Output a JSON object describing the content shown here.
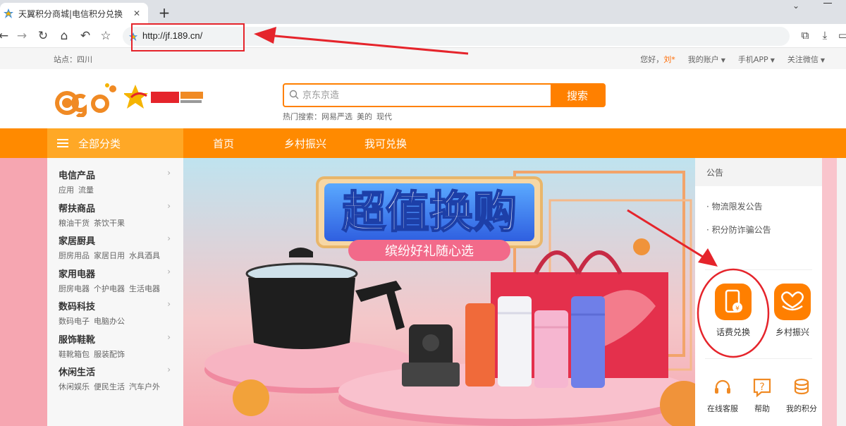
{
  "browser": {
    "tab_title": "天翼积分商城|电信积分兑换",
    "close_glyph": "✕",
    "new_tab_glyph": "+",
    "url": "http://jf.189.cn/"
  },
  "topbar": {
    "region": "站点：四川",
    "greeting": "您好，",
    "username": "刘*",
    "links": [
      "我的账户",
      "手机APP",
      "关注微信"
    ]
  },
  "header": {
    "search_placeholder": "京东京造",
    "search_button": "搜索",
    "hot_label": "热门搜索：",
    "hot_terms": [
      "网易严选",
      "美的",
      "现代"
    ]
  },
  "nav": {
    "all_categories": "全部分类",
    "links": [
      "首页",
      "乡村振兴",
      "我可兑换"
    ]
  },
  "categories": [
    {
      "name": "电信产品",
      "subs": [
        "应用",
        "流量"
      ]
    },
    {
      "name": "帮扶商品",
      "subs": [
        "粮油干货",
        "茶饮干果"
      ]
    },
    {
      "name": "家居厨具",
      "subs": [
        "厨房用品",
        "家居日用",
        "水具酒具"
      ]
    },
    {
      "name": "家用电器",
      "subs": [
        "厨房电器",
        "个护电器",
        "生活电器"
      ]
    },
    {
      "name": "数码科技",
      "subs": [
        "数码电子",
        "电脑办公"
      ]
    },
    {
      "name": "服饰鞋靴",
      "subs": [
        "鞋靴箱包",
        "服装配饰"
      ]
    },
    {
      "name": "休闲生活",
      "subs": [
        "休闲娱乐",
        "便民生活",
        "汽车户外"
      ]
    }
  ],
  "banner": {
    "headline": "超值换购",
    "subline": "缤纷好礼随心选"
  },
  "panel": {
    "notice_title": "公告",
    "notices": [
      "物流限发公告",
      "积分防诈骗公告"
    ],
    "services": [
      "话费兑换",
      "乡村振兴"
    ],
    "help": [
      "在线客服",
      "帮助",
      "我的积分"
    ]
  },
  "colors": {
    "brand_orange": "#ff8000",
    "nav_orange": "#ff8a00",
    "annotation_red": "#e5242b"
  }
}
